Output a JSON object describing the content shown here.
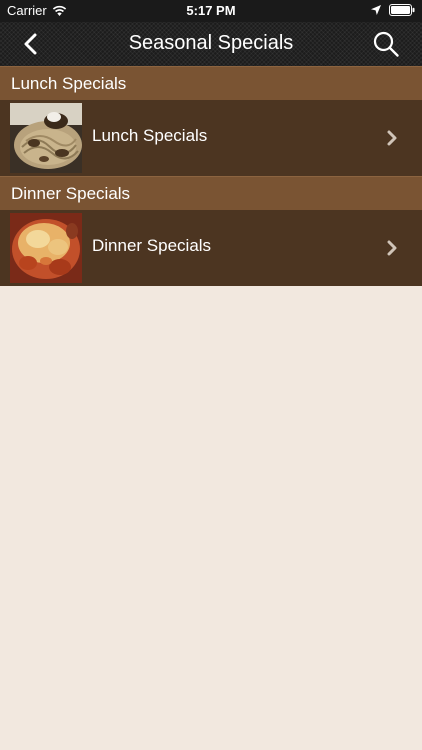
{
  "status_bar": {
    "carrier": "Carrier",
    "time": "5:17 PM",
    "icons": [
      "wifi-icon",
      "location-arrow-icon",
      "battery-icon"
    ]
  },
  "nav": {
    "title": "Seasonal Specials",
    "back_icon": "back-chevron-icon",
    "search_icon": "search-icon"
  },
  "sections": [
    {
      "header": "Lunch Specials",
      "item": {
        "label": "Lunch Specials",
        "image": "pasta-dish-photo"
      }
    },
    {
      "header": "Dinner Specials",
      "item": {
        "label": "Dinner Specials",
        "image": "baked-dish-photo"
      }
    }
  ],
  "colors": {
    "status_bar": "#1a1a1a",
    "nav_bar": "#1c1c1c",
    "section_header": "#7a5433",
    "row_background": "#4c3521",
    "page_background": "#f2e8df",
    "chevron": "#d0c4b8"
  }
}
